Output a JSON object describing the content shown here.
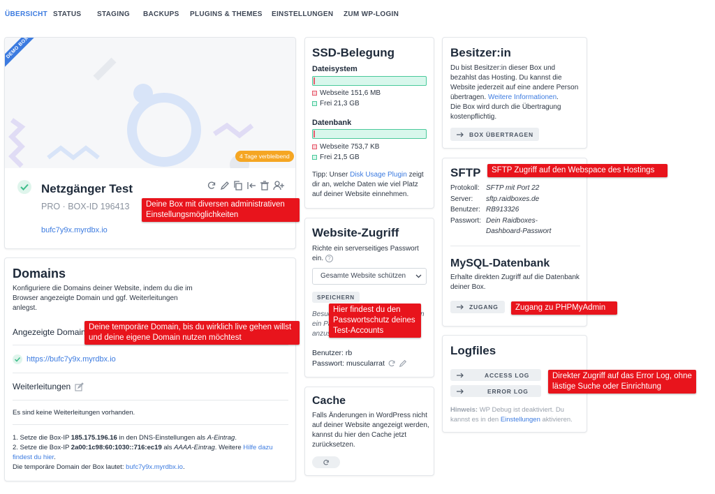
{
  "nav": {
    "items": [
      "ÜBERSICHT",
      "STATUS",
      "STAGING",
      "BACKUPS",
      "PLUGINS & THEMES",
      "EINSTELLUNGEN",
      "ZUM WP-LOGIN"
    ]
  },
  "box": {
    "ribbon": "DEMO BOX",
    "days_badge": "4 Tage verbleibend",
    "name": "Netzgänger Test",
    "meta": "PRO · BOX-ID 196413",
    "url": "bufc7y9x.myrdbx.io"
  },
  "domains": {
    "title": "Domains",
    "description": "Konfiguriere die Domains deiner Website, indem du die im Browser angezeigte Domain und ggf. Weiterleitungen anlegst.",
    "displayed_label": "Angezeigte Domain",
    "displayed_value": "https://bufc7y9x.myrdbx.io",
    "redirects_label": "Weiterleitungen",
    "no_redirects": "Es sind keine Weiterleitungen vorhanden.",
    "step1_a": "1. Setze die Box-IP ",
    "step1_ip": "185.175.196.16",
    "step1_b": " in den DNS-Einstellungen als ",
    "step1_type": "A-Eintrag",
    "step1_c": ".",
    "step2_a": "2. Setze die Box-IP ",
    "step2_ip": "2a00:1c98:60:1030::716:ec19",
    "step2_b": " als ",
    "step2_type": "AAAA-Eintrag",
    "step2_c": ". Weitere ",
    "step2_link": "Hilfe dazu findest du hier",
    "step2_d": ".",
    "temp_a": "Die temporäre Domain der Box lautet: ",
    "temp_link": "bufc7y9x.myrdbx.io",
    "temp_b": "."
  },
  "ssd": {
    "title": "SSD-Belegung",
    "fs_label": "Dateisystem",
    "fs_website": "Webseite 151,6 MB",
    "fs_free": "Frei 21,3 GB",
    "db_label": "Datenbank",
    "db_website": "Webseite 753,7 KB",
    "db_free": "Frei 21,5 GB",
    "tip_a": "Tipp: Unser ",
    "tip_link": "Disk Usage Plugin",
    "tip_b": " zeigt dir an, welche Daten wie viel Platz auf deiner Website einnehmen.",
    "fs_used_fraction": 0.007,
    "db_used_fraction": 0.0001
  },
  "access": {
    "title": "Website-Zugriff",
    "desc": "Richte ein serverseitiges Passwort ein.",
    "select_value": "Gesamte Website schützen",
    "save_label": "SPEICHERN",
    "hidden_line1": "Besuc",
    "hidden_line1_end": "n",
    "hidden_line2": "ein Pa",
    "hidden_line3": "anzus",
    "user_label": "Benutzer: rb",
    "pass_label": "Passwort: muscularrat"
  },
  "cache": {
    "title": "Cache",
    "desc": "Falls Änderungen in WordPress nicht auf deiner Website angezeigt werden, kannst du hier den Cache jetzt zurücksetzen."
  },
  "owner": {
    "title": "Besitzer:in",
    "desc_a": "Du bist Besitzer:in dieser Box und bezahlst das Hosting. Du kannst die Website jederzeit auf eine andere Person übertragen. ",
    "desc_link": "Weitere Informationen",
    "desc_b": ".",
    "desc_c": "Die Box wird durch die Übertragung kostenpflichtig.",
    "transfer_label": "BOX ÜBERTRAGEN"
  },
  "sftp": {
    "title": "SFTP",
    "k1": "Protokoll:",
    "v1": "SFTP mit Port 22",
    "k2": "Server:",
    "v2": "sftp.raidboxes.de",
    "k3": "Benutzer:",
    "v3": "RB913326",
    "k4": "Passwort:",
    "v4": "Dein Raidboxes-Dashboard-Passwort"
  },
  "mysql": {
    "title": "MySQL-Datenbank",
    "desc": "Erhalte direkten Zugriff auf die Datenbank deiner Box.",
    "access_label": "ZUGANG"
  },
  "logs": {
    "title": "Logfiles",
    "access_log": "ACCESS LOG",
    "error_log": "ERROR LOG",
    "hint_bold": "Hinweis:",
    "hint_a": " WP Debug ist deaktiviert. Du kannst es in den ",
    "hint_link": "Einstellungen",
    "hint_b": " aktivieren."
  },
  "annotations": {
    "box": "Deine Box mit diversen administrativen Einstellungsmöglichkeiten",
    "domain": "Deine temporäre Domain, bis du wirklich live gehen willst und deine eigene Domain nutzen möchtest",
    "password": "Hier findest du den Passwortschutz deines Test-Accounts",
    "sftp": "SFTP Zugriff auf den Webspace des Hostings",
    "phpmyadmin": "Zugang zu PHPMyAdmin",
    "errorlog": "Direkter Zugriff auf das Error Log, ohne lästige Suche oder Einrichtung"
  },
  "colors": {
    "accent": "#3c7be0",
    "annotation_red": "#e8141c",
    "success_green": "#49c99a",
    "badge_orange": "#f5a623"
  }
}
